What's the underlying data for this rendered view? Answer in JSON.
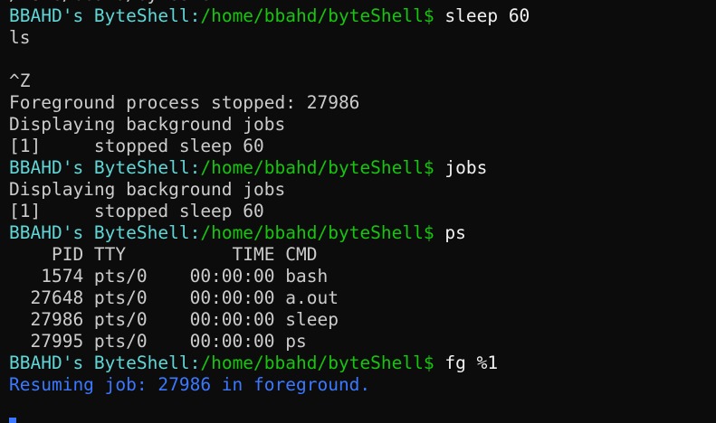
{
  "terminal": {
    "colors": {
      "background": "#0c0c0c",
      "text": "#cccccc",
      "prompt_user": "#61d6d6",
      "prompt_path": "#16c60c",
      "info": "#3b78ff"
    },
    "lines": [
      {
        "kind": "out",
        "text": "/home/bbahd/byteShell"
      },
      {
        "kind": "prompt",
        "user": "BBAHD's ByteShell",
        "sep": ":",
        "path": "/home/bbahd/byteShell",
        "dollar": "$ ",
        "cmd": "sleep 60"
      },
      {
        "kind": "out",
        "text": "ls"
      },
      {
        "kind": "out",
        "text": ""
      },
      {
        "kind": "out",
        "text": "^Z"
      },
      {
        "kind": "out",
        "text": "Foreground process stopped: 27986"
      },
      {
        "kind": "out",
        "text": "Displaying background jobs"
      },
      {
        "kind": "out",
        "text": "[1]     stopped sleep 60"
      },
      {
        "kind": "prompt",
        "user": "BBAHD's ByteShell",
        "sep": ":",
        "path": "/home/bbahd/byteShell",
        "dollar": "$ ",
        "cmd": "jobs"
      },
      {
        "kind": "out",
        "text": "Displaying background jobs"
      },
      {
        "kind": "out",
        "text": "[1]     stopped sleep 60"
      },
      {
        "kind": "prompt",
        "user": "BBAHD's ByteShell",
        "sep": ":",
        "path": "/home/bbahd/byteShell",
        "dollar": "$ ",
        "cmd": "ps"
      },
      {
        "kind": "out",
        "text": "    PID TTY          TIME CMD"
      },
      {
        "kind": "out",
        "text": "   1574 pts/0    00:00:00 bash"
      },
      {
        "kind": "out",
        "text": "  27648 pts/0    00:00:00 a.out"
      },
      {
        "kind": "out",
        "text": "  27986 pts/0    00:00:00 sleep"
      },
      {
        "kind": "out",
        "text": "  27995 pts/0    00:00:00 ps"
      },
      {
        "kind": "prompt",
        "user": "BBAHD's ByteShell",
        "sep": ":",
        "path": "/home/bbahd/byteShell",
        "dollar": "$ ",
        "cmd": "fg %1"
      },
      {
        "kind": "info",
        "text": "Resuming job: 27986 in foreground."
      }
    ]
  }
}
